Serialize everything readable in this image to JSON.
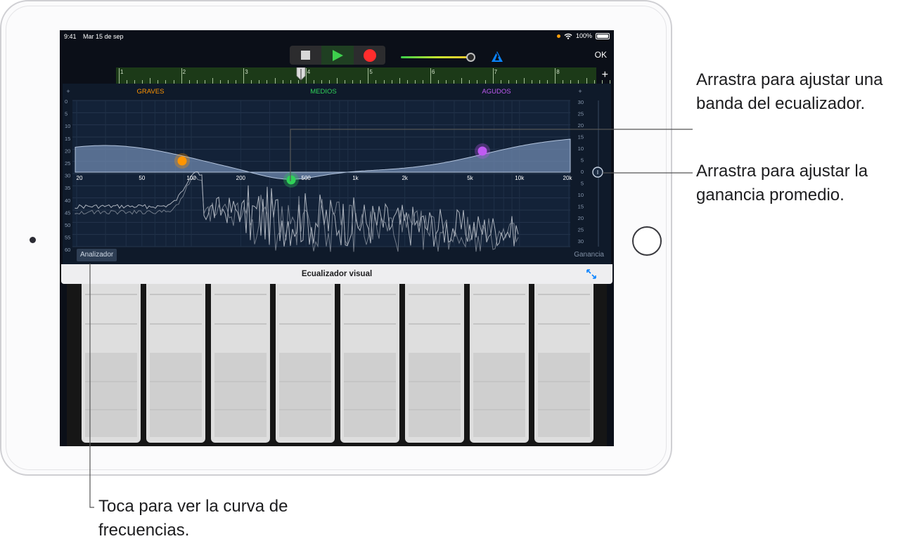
{
  "status_bar": {
    "time": "9:41",
    "date": "Mar 15 de sep",
    "battery": "100%"
  },
  "toolbar": {
    "ok_label": "OK"
  },
  "ruler": {
    "bars": [
      "1",
      "2",
      "3",
      "4",
      "5",
      "6",
      "7",
      "8"
    ],
    "add_label": "+"
  },
  "eq": {
    "band_labels": [
      "GRAVES",
      "MEDIOS",
      "AGUDOS"
    ],
    "band_colors": [
      "#ff9500",
      "#30d158",
      "#bf5af2"
    ],
    "plus_left": "+",
    "plus_right": "+",
    "left_scale": [
      "0",
      "5",
      "10",
      "15",
      "20",
      "25",
      "30",
      "35",
      "40",
      "45",
      "50",
      "55",
      "60"
    ],
    "right_scale": [
      "30",
      "25",
      "20",
      "15",
      "10",
      "5",
      "0",
      "5",
      "10",
      "15",
      "20",
      "25",
      "30"
    ],
    "freq_labels": [
      "20",
      "50",
      "100",
      "200",
      "500",
      "1k",
      "2k",
      "5k",
      "10k",
      "20k"
    ],
    "analyzer_label": "Analizador",
    "gain_label": "Ganancia"
  },
  "plugin": {
    "title": "Ecualizador visual"
  },
  "callouts": {
    "band": "Arrastra para ajustar una banda del ecualizador.",
    "gain": "Arrastra para ajustar la ganancia promedio.",
    "analyzer": "Toca para ver la curva de frecuencias."
  },
  "icons": {
    "stop": "stop-icon",
    "play": "play-icon",
    "record": "record-icon",
    "tuner": "tuner-icon",
    "expand": "expand-icon",
    "wifi": "wifi-icon",
    "battery": "battery-icon"
  }
}
